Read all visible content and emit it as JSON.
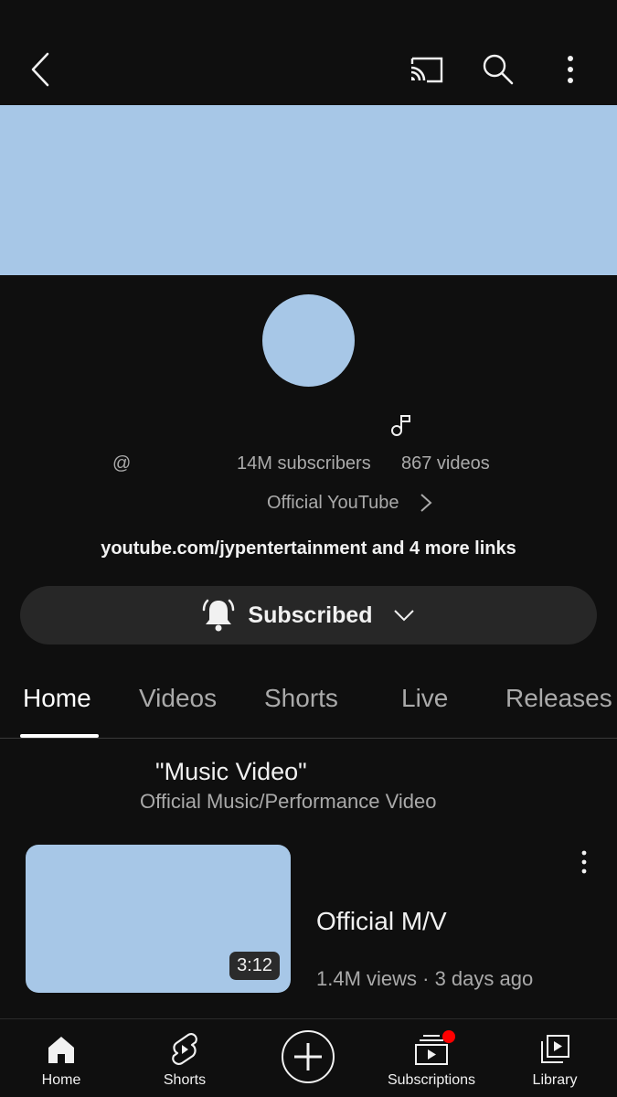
{
  "topbar": {
    "icons": [
      "back-icon",
      "cast-icon",
      "search-icon",
      "more-vert-icon"
    ]
  },
  "channel": {
    "banner_color": "#a7c7e7",
    "avatar_color": "#a7c7e7",
    "handle_prefix": "@",
    "subscribers": "14M subscribers",
    "videos": "867 videos",
    "description": "Official YouTube",
    "links": "youtube.com/jypentertainment and 4 more links"
  },
  "subscribe": {
    "label": "Subscribed"
  },
  "tabs": [
    {
      "label": "Home",
      "active": true
    },
    {
      "label": "Videos",
      "active": false
    },
    {
      "label": "Shorts",
      "active": false
    },
    {
      "label": "Live",
      "active": false
    },
    {
      "label": "Releases",
      "active": false
    }
  ],
  "section": {
    "title": "\"Music Video\"",
    "subtitle": "Official Music/Performance Video"
  },
  "video": {
    "title": "Official M/V",
    "duration": "3:12",
    "views": "1.4M views",
    "separator": "·",
    "age": "3 days ago",
    "meta": "1.4M views · 3 days ago",
    "thumbnail_color": "#a7c7e7"
  },
  "bottom_nav": [
    {
      "label": "Home",
      "icon": "home-icon"
    },
    {
      "label": "Shorts",
      "icon": "shorts-icon"
    },
    {
      "label": "",
      "icon": "create-icon"
    },
    {
      "label": "Subscriptions",
      "icon": "subscriptions-icon",
      "badge": true
    },
    {
      "label": "Library",
      "icon": "library-icon"
    }
  ],
  "colors": {
    "background": "#0f0f0f",
    "text_primary": "#f1f1f1",
    "text_secondary": "#aaaaaa",
    "button_bg": "#272727",
    "notification_dot": "#ff0000"
  }
}
